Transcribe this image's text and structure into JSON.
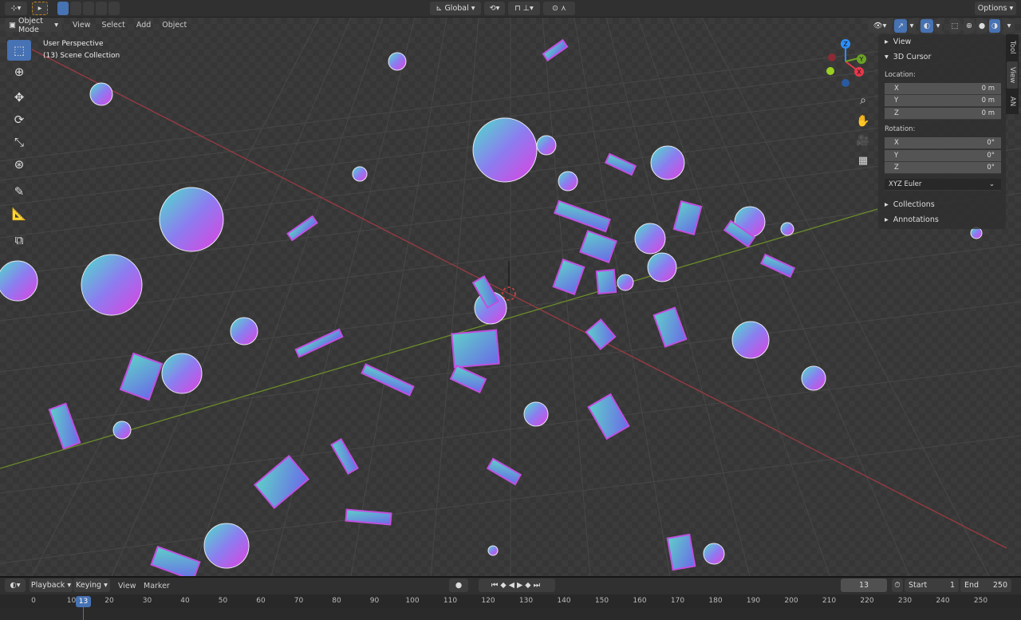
{
  "topbar": {
    "orientation": "Global",
    "options": "Options"
  },
  "header": {
    "mode": "Object Mode",
    "menus": [
      "View",
      "Select",
      "Add",
      "Object"
    ]
  },
  "overlay": {
    "view_name": "User Perspective",
    "collection": "(13) Scene Collection"
  },
  "toolbar": {
    "tools": [
      "select-box",
      "cursor",
      "move",
      "rotate",
      "scale",
      "transform",
      "annotate",
      "measure",
      "add-cube"
    ]
  },
  "gizmo": {
    "axes": [
      "X",
      "Y",
      "Z"
    ],
    "colors": {
      "x": "#e8374b",
      "y": "#6ba225",
      "z": "#2c8fff"
    }
  },
  "npanel": {
    "sections": {
      "view": "View",
      "cursor": "3D Cursor",
      "collections": "Collections",
      "annotations": "Annotations"
    },
    "location_label": "Location:",
    "location": [
      {
        "axis": "X",
        "value": "0 m"
      },
      {
        "axis": "Y",
        "value": "0 m"
      },
      {
        "axis": "Z",
        "value": "0 m"
      }
    ],
    "rotation_label": "Rotation:",
    "rotation": [
      {
        "axis": "X",
        "value": "0°"
      },
      {
        "axis": "Y",
        "value": "0°"
      },
      {
        "axis": "Z",
        "value": "0°"
      }
    ],
    "rotation_mode": "XYZ Euler",
    "tabs": [
      "Tool",
      "View",
      "AN"
    ]
  },
  "timeline": {
    "menus": [
      "Playback",
      "Keying",
      "View",
      "Marker"
    ],
    "current_frame": "13",
    "start_label": "Start",
    "start": "1",
    "end_label": "End",
    "end": "250",
    "ticks": [
      "0",
      "10",
      "20",
      "30",
      "40",
      "50",
      "60",
      "70",
      "80",
      "90",
      "100",
      "110",
      "120",
      "130",
      "140",
      "150",
      "160",
      "170",
      "180",
      "190",
      "200",
      "210",
      "220",
      "230",
      "240",
      "250"
    ]
  },
  "colors": {
    "accent": "#4772b3",
    "viewport": "#3a3a3a"
  }
}
